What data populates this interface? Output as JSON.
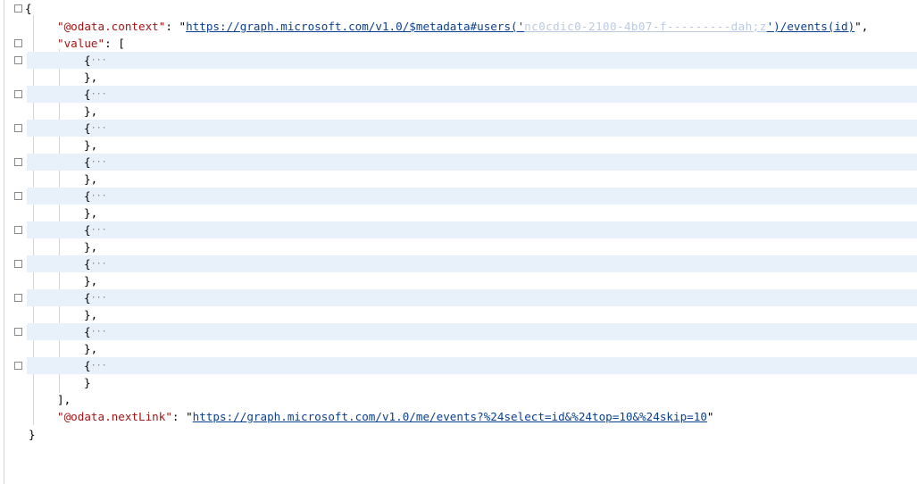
{
  "json_view": {
    "open_brace": "{",
    "close_brace": "}",
    "context_key": "\"@odata.context\"",
    "context_colon": ": ",
    "context_quote_open": "\"",
    "context_url": "https://graph.microsoft.com/v1.0/$metadata#users('",
    "context_url_redacted": "nc0cdic0-2100-4b07-f---------dah;z",
    "context_url_tail": "')/events(id)",
    "context_quote_close": "\",",
    "value_key": "\"value\"",
    "value_colon": ": [",
    "item_open": "{",
    "item_ellipsis": "···",
    "item_close_comma": "},",
    "item_close_last": "}",
    "array_close": "],",
    "nextlink_key": "\"@odata.nextLink\"",
    "nextlink_colon": ": ",
    "nextlink_quote_open": "\"",
    "nextlink_url": "https://graph.microsoft.com/v1.0/me/events?%24select=id&%24top=10&%24skip=10",
    "nextlink_quote_close": "\"",
    "collapsed_item_count": 10
  }
}
